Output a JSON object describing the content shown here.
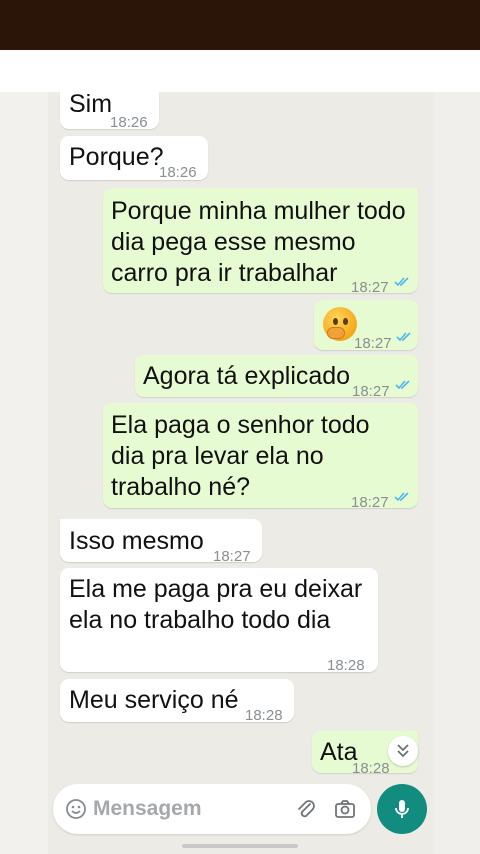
{
  "messages": [
    {
      "direction": "in",
      "lines": [
        "Sim"
      ],
      "time": "18:26"
    },
    {
      "direction": "in",
      "lines": [
        "Porque?"
      ],
      "time": "18:26"
    },
    {
      "direction": "out",
      "lines": [
        "Porque minha mulher todo",
        "dia pega esse mesmo",
        "carro pra ir trabalhar"
      ],
      "time": "18:27",
      "read": true
    },
    {
      "direction": "out",
      "lines": [],
      "emoji": "thinking-face",
      "time": "18:27",
      "read": true
    },
    {
      "direction": "out",
      "lines": [
        "Agora tá explicado"
      ],
      "time": "18:27",
      "read": true
    },
    {
      "direction": "out",
      "lines": [
        "Ela paga o senhor todo",
        "dia pra levar ela no",
        "trabalho né?"
      ],
      "time": "18:27",
      "read": true
    },
    {
      "direction": "in",
      "lines": [
        "Isso mesmo"
      ],
      "time": "18:27"
    },
    {
      "direction": "in",
      "lines": [
        "Ela me paga pra eu deixar",
        "ela no trabalho todo dia"
      ],
      "time": "18:28"
    },
    {
      "direction": "in",
      "lines": [
        "Meu serviço né"
      ],
      "time": "18:28"
    },
    {
      "direction": "out",
      "lines": [
        "Ata"
      ],
      "time": "18:28",
      "read": true
    }
  ],
  "composer": {
    "placeholder": "Mensagem",
    "icons": [
      "emoji-icon",
      "attach-icon",
      "camera-icon",
      "mic-icon"
    ]
  },
  "scroll_button_icon": "double-chevron-down-icon",
  "colors": {
    "incoming_bubble": "#ffffff",
    "outgoing_bubble": "#e7fbd3",
    "accent": "#128c7e",
    "read_check": "#4fb6ec"
  }
}
